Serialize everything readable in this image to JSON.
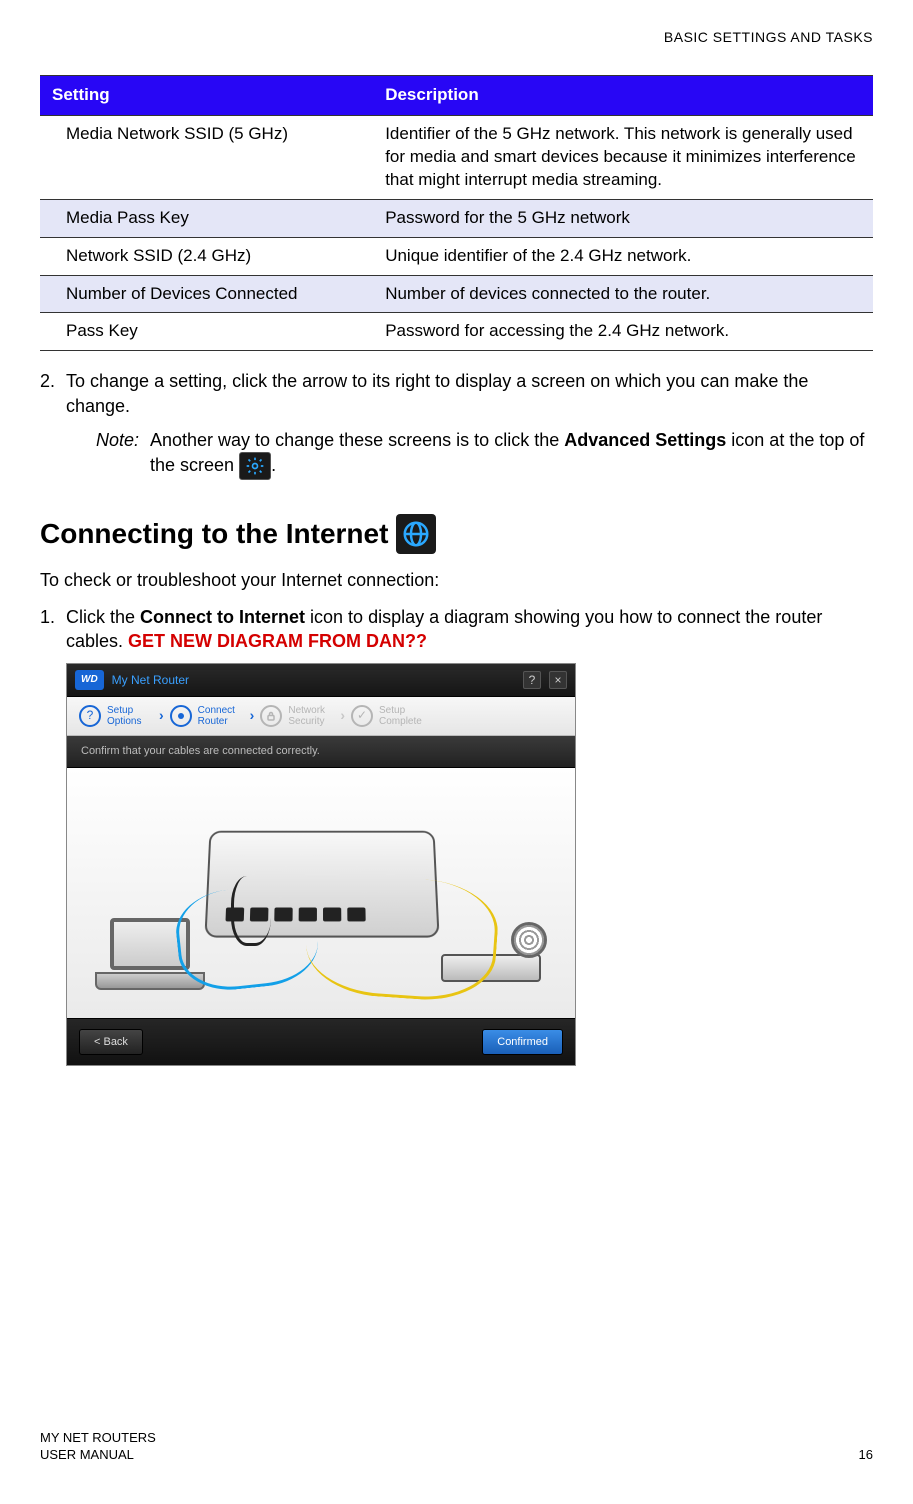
{
  "header": {
    "section": "BASIC SETTINGS AND TASKS"
  },
  "table": {
    "headers": {
      "setting": "Setting",
      "description": "Description"
    },
    "rows": [
      {
        "setting": "Media Network SSID (5 GHz)",
        "description": "Identifier of the 5 GHz network. This network is generally used for media and smart devices because it minimizes interference that might interrupt media streaming."
      },
      {
        "setting": "Media Pass Key",
        "description": "Password for the 5 GHz network"
      },
      {
        "setting": "Network SSID (2.4 GHz)",
        "description": "Unique identifier of the 2.4 GHz network."
      },
      {
        "setting": "Number of Devices Connected",
        "description": "Number of devices connected to the router."
      },
      {
        "setting": "Pass Key",
        "description": "Password for accessing the 2.4 GHz network."
      }
    ]
  },
  "step2": {
    "number": "2.",
    "text": "To change a setting, click the arrow to its right to display a screen on which you can make the change.",
    "note_label": "Note:",
    "note_before": "Another way to change these screens is to click the ",
    "note_bold": "Advanced Settings",
    "note_after_first": " icon at the top of the screen",
    "note_period": "."
  },
  "section2": {
    "title": "Connecting to the Internet",
    "intro": "To check or troubleshoot your Internet connection:",
    "step1_num": "1.",
    "step1_a": "Click the ",
    "step1_bold": "Connect to Internet",
    "step1_b": " icon to display a diagram showing you how to connect the router cables. ",
    "step1_red": "GET NEW DIAGRAM FROM DAN??"
  },
  "app": {
    "logo": "WD",
    "title": "My Net Router",
    "help": "?",
    "close": "×",
    "steps": {
      "s1": "Setup\nOptions",
      "s2": "Connect\nRouter",
      "s3": "Network\nSecurity",
      "s4": "Setup\nComplete"
    },
    "subbar": "Confirm that your cables are connected correctly.",
    "back": "< Back",
    "confirmed": "Confirmed"
  },
  "footer": {
    "line1": "MY NET ROUTERS",
    "line2": "USER MANUAL",
    "page": "16"
  }
}
